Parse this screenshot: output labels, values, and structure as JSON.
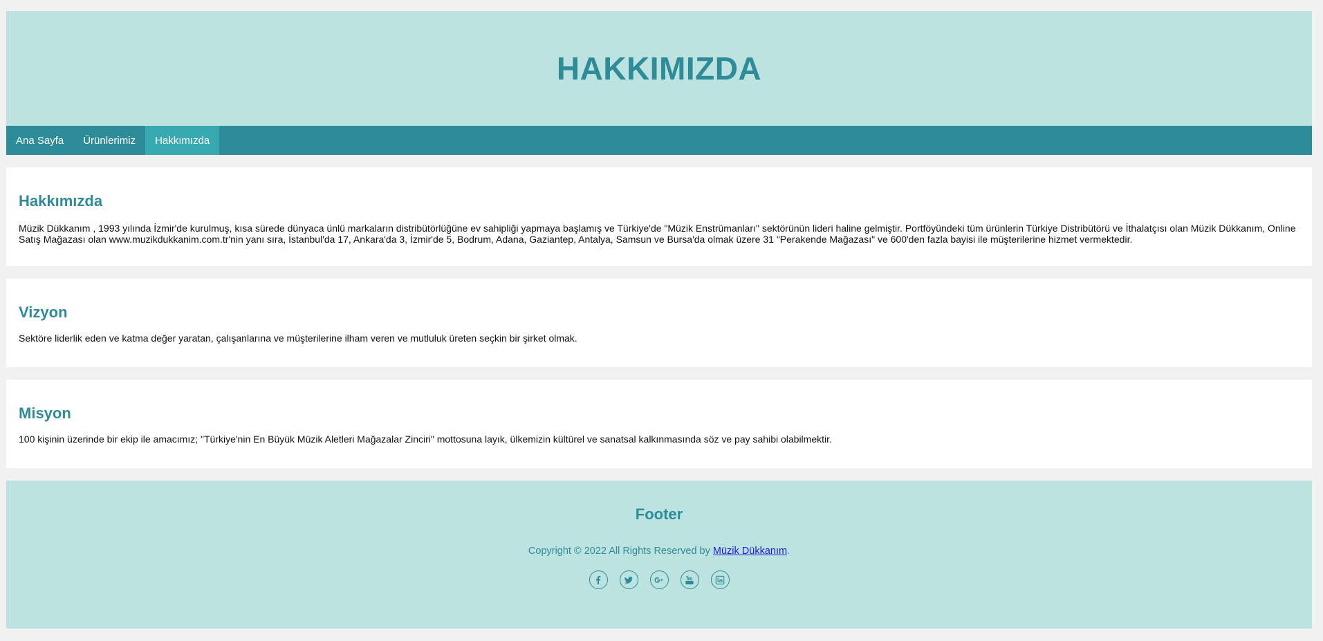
{
  "header": {
    "title": "HAKKIMIZDA"
  },
  "nav": {
    "items": [
      {
        "label": "Ana Sayfa",
        "active": false
      },
      {
        "label": "Ürünlerimiz",
        "active": false
      },
      {
        "label": "Hakkımızda",
        "active": true
      }
    ]
  },
  "sections": {
    "about": {
      "heading": "Hakkımızda",
      "text": "Müzik Dükkanım , 1993 yılında İzmir'de kurulmuş, kısa sürede dünyaca ünlü markaların distribütörlüğüne ev sahipliği yapmaya başlamış ve Türkiye'de \"Müzik Enstrümanları\" sektörünün lideri haline gelmiştir. Portföyündeki tüm ürünlerin Türkiye Distribütörü ve İthalatçısı olan Müzik Dükkanım, Online Satış Mağazası olan www.muzikdukkanim.com.tr'nin yanı sıra, İstanbul'da 17, Ankara'da 3, İzmir'de 5, Bodrum, Adana, Gaziantep, Antalya, Samsun ve Bursa'da olmak üzere 31 \"Perakende Mağazası\" ve 600'den fazla bayisi ile müşterilerine hizmet vermektedir."
    },
    "vision": {
      "heading": "Vizyon",
      "text": "Sektöre liderlik eden ve katma değer yaratan, çalışanlarına ve müşterilerine ilham veren ve mutluluk üreten seçkin bir şirket olmak."
    },
    "mission": {
      "heading": "Misyon",
      "text": "100 kişinin üzerinde bir ekip ile amacımız; \"Türkiye'nin En Büyük Müzik Aletleri Mağazalar Zinciri\" mottosuna layık, ülkemizin kültürel ve sanatsal kalkınmasında söz ve pay sahibi olabilmektir."
    }
  },
  "footer": {
    "title": "Footer",
    "copyright_prefix": "Copyright © 2022 All Rights Reserved by ",
    "copyright_link": "Müzik Dükkanım",
    "copyright_suffix": ".",
    "social_icons": [
      "facebook-icon",
      "twitter-icon",
      "google-plus-icon",
      "youtube-icon",
      "linkedin-icon"
    ]
  },
  "colors": {
    "page_bg": "#f1f1f1",
    "header_bg": "#bde3e1",
    "primary": "#2e8c98",
    "nav_active": "#38a8b1",
    "link": "#1a1ae0"
  }
}
